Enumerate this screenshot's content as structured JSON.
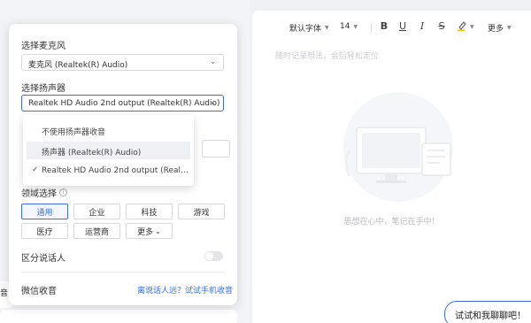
{
  "settings": {
    "mic_label": "选择麦克风",
    "mic_value": "麦克风 (Realtek(R) Audio)",
    "speaker_label": "选择扬声器",
    "speaker_value": "Realtek HD Audio 2nd output (Realtek(R) Audio)",
    "speaker_options": [
      "不使用扬声器收音",
      "扬声器 (Realtek(R) Audio)",
      "Realtek HD Audio 2nd output (Realtek(R) Audio)"
    ],
    "domain_label": "领域选择",
    "domains": [
      "通用",
      "企业",
      "科技",
      "游戏",
      "医疗",
      "运营商",
      "更多"
    ],
    "speaker_diarization_label": "区分说话人",
    "wechat_label": "微信收音",
    "wechat_link": "离说话人远？试试手机收音"
  },
  "editor": {
    "font": "默认字体",
    "size": "14",
    "more": "更多",
    "placeholder": "随时记录想法，会后轻松定位",
    "empty_text": "思想在心中，笔记在手中！"
  },
  "background": {
    "partial_label": "音"
  },
  "chat": {
    "bubble": "试试和我聊聊吧！"
  },
  "colors": {
    "accent": "#3b6cf0"
  }
}
